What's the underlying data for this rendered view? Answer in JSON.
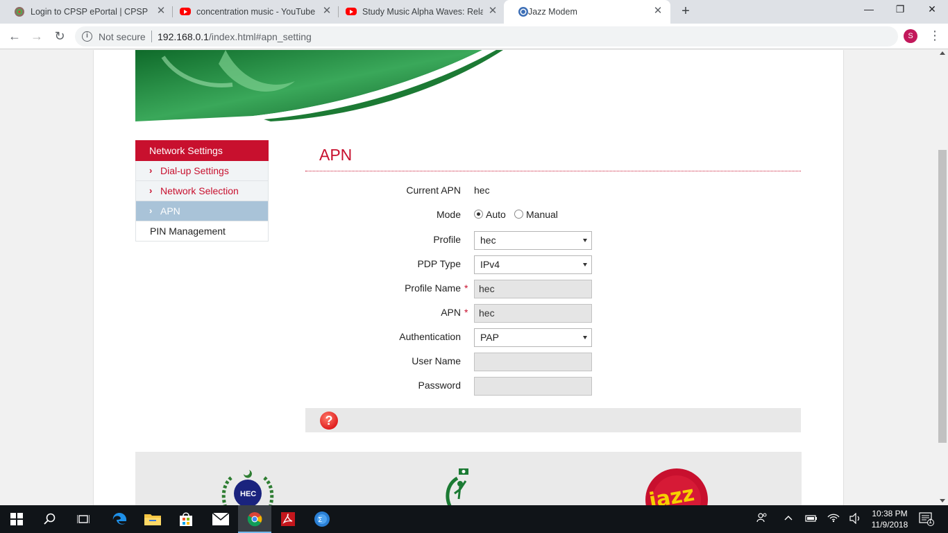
{
  "browser": {
    "tabs": [
      {
        "title": "Login to CPSP ePortal | CPSP",
        "icon": "cpsp-favicon-icon",
        "active": false
      },
      {
        "title": "concentration music - YouTube",
        "icon": "youtube-icon",
        "active": false
      },
      {
        "title": "Study Music Alpha Waves: Relaxi",
        "icon": "youtube-icon",
        "active": false
      },
      {
        "title": "Jazz Modem",
        "icon": "globe-favicon-icon",
        "active": true
      }
    ],
    "new_tab_label": "+",
    "address": {
      "security_label": "Not secure",
      "url_host": "192.168.0.1",
      "url_path": "/index.html#apn_setting"
    },
    "profile_initial": "S"
  },
  "sidebar": {
    "header": "Network Settings",
    "items": [
      {
        "label": "Dial-up Settings",
        "active": false
      },
      {
        "label": "Network Selection",
        "active": false
      },
      {
        "label": "APN",
        "active": true
      }
    ],
    "pin_label": "PIN Management"
  },
  "main": {
    "title": "APN",
    "current_apn_label": "Current APN",
    "current_apn_value": "hec",
    "mode_label": "Mode",
    "mode_options": [
      "Auto",
      "Manual"
    ],
    "mode_selected": "Auto",
    "profile_label": "Profile",
    "profile_value": "hec",
    "pdp_type_label": "PDP Type",
    "pdp_type_value": "IPv4",
    "profile_name_label": "Profile Name",
    "profile_name_value": "hec",
    "apn_label": "APN",
    "apn_value": "hec",
    "required_mark": "*",
    "authentication_label": "Authentication",
    "authentication_value": "PAP",
    "username_label": "User Name",
    "username_value": "",
    "password_label": "Password",
    "password_value": "",
    "help_symbol": "?"
  },
  "footer": {
    "logo_hec_text": "HEC",
    "logo_jazz_text": "jazz"
  },
  "taskbar": {
    "time": "10:38 PM",
    "date": "11/9/2018",
    "notification_count": "1"
  },
  "colors": {
    "brand_red": "#c8102e",
    "active_nav": "#a9c3d8",
    "banner_green": "#1e8a3a"
  }
}
